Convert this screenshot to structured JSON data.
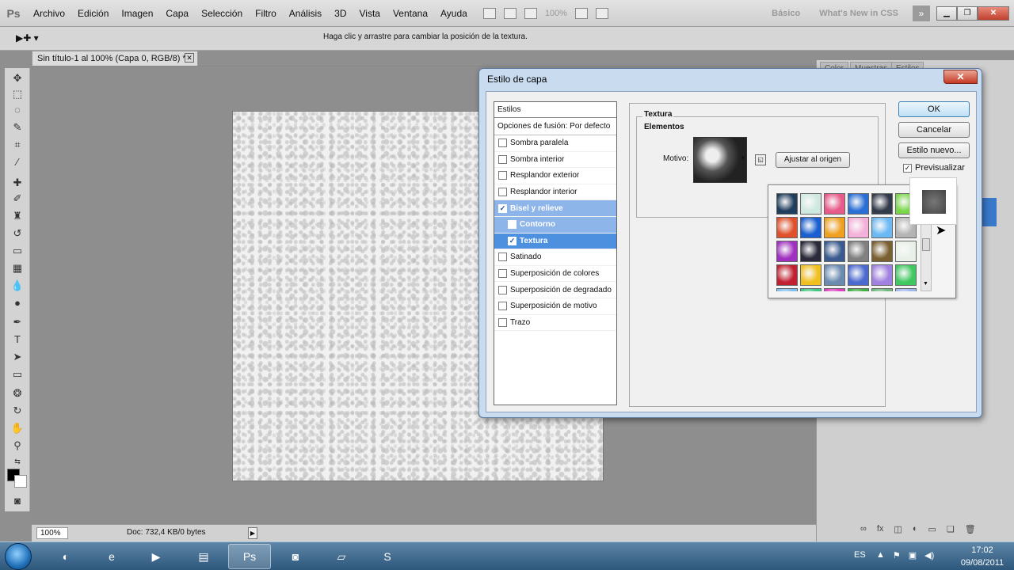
{
  "app": {
    "logo": "Ps",
    "menus": [
      "Archivo",
      "Edición",
      "Imagen",
      "Capa",
      "Selección",
      "Filtro",
      "Análisis",
      "3D",
      "Vista",
      "Ventana",
      "Ayuda"
    ],
    "zoom_display": "100%",
    "workspaces": [
      "Básico",
      "What's New in CSS"
    ],
    "workspace_more": "»"
  },
  "options_bar": {
    "tool_glyph": "▶✚ ▾",
    "hint": "Haga clic y arrastre para cambiar la posición de la textura."
  },
  "document": {
    "tab_title": "Sin título-1 al 100% (Capa 0, RGB/8) *",
    "close_glyph": "✕",
    "zoom": "100%",
    "doc_info": "Doc: 732,4 KB/0 bytes"
  },
  "panels": {
    "tabs": [
      "Color",
      "Muestras",
      "Estilos"
    ]
  },
  "dialog": {
    "title": "Estilo de capa",
    "close_glyph": "✕",
    "styles_header": "Estilos",
    "blend_options": "Opciones de fusión: Por defecto",
    "styles": [
      {
        "label": "Sombra paralela",
        "checked": false
      },
      {
        "label": "Sombra interior",
        "checked": false
      },
      {
        "label": "Resplandor exterior",
        "checked": false
      },
      {
        "label": "Resplandor interior",
        "checked": false
      },
      {
        "label": "Bisel y relieve",
        "checked": true
      },
      {
        "label": "Contorno",
        "checked": false
      },
      {
        "label": "Textura",
        "checked": true
      },
      {
        "label": "Satinado",
        "checked": false
      },
      {
        "label": "Superposición de colores",
        "checked": false
      },
      {
        "label": "Superposición de degradado",
        "checked": false
      },
      {
        "label": "Superposición de motivo",
        "checked": false
      },
      {
        "label": "Trazo",
        "checked": false
      }
    ],
    "texture_title": "Textura",
    "elements_title": "Elementos",
    "pattern_label": "Motivo:",
    "snap_button": "Ajustar al origen",
    "ok": "OK",
    "cancel": "Cancelar",
    "new_style": "Estilo nuevo...",
    "preview_label": "Previsualizar",
    "preview_checked": true,
    "picker_swatches": [
      "#1f3d5c",
      "#cfe8e0",
      "#e85a8a",
      "#2a6fd6",
      "#333a4a",
      "#7ad64a",
      "#e0502a",
      "#1a5fd0",
      "#f0a020",
      "#f4b0d8",
      "#6ab8f4",
      "#b4b4b4",
      "#a030c0",
      "#2a2a3a",
      "#3a5a90",
      "#808080",
      "#7a6030",
      "#e8f0e8",
      "#c02030",
      "#f0c020",
      "#6a8ab0",
      "#4a6ad0",
      "#a080e0",
      "#40c860",
      "#80c0f0",
      "#40c880",
      "#e040c0",
      "#40b040",
      "#70b880",
      "#a0b8f0"
    ]
  },
  "taskbar": {
    "apps": [
      "◐",
      "e",
      "▶",
      "▤",
      "Ps",
      "◙",
      "▱",
      "S"
    ],
    "language": "ES",
    "time": "17:02",
    "date": "09/08/2011"
  }
}
